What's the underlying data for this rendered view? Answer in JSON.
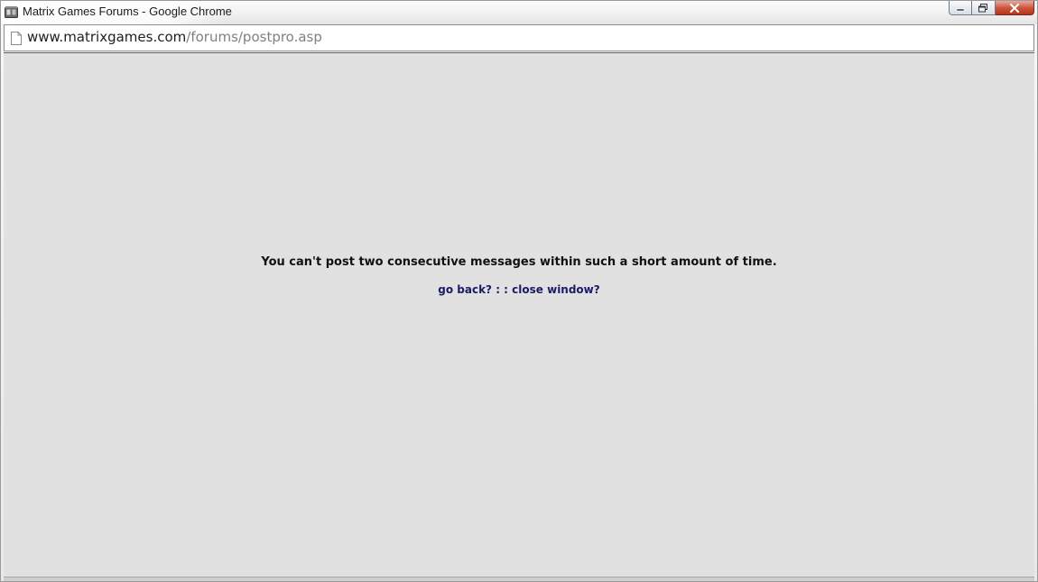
{
  "window": {
    "title": "Matrix Games Forums - Google Chrome",
    "controls": {
      "minimize": "minimize-icon",
      "maximize": "maximize-icon",
      "close": "close-icon"
    }
  },
  "address_bar": {
    "host": "www.matrixgames.com",
    "path": "/forums/postpro.asp",
    "icon": "page-icon"
  },
  "page": {
    "message": "You can't post two consecutive messages within such a short amount of time.",
    "links": {
      "go_back": "go back?",
      "separator": " : : ",
      "close_window": "close window?"
    }
  },
  "colors": {
    "page_background": "#e1e1e1",
    "message_text": "#111111",
    "link_text": "#1b1b66",
    "close_button": "#c9523a"
  }
}
